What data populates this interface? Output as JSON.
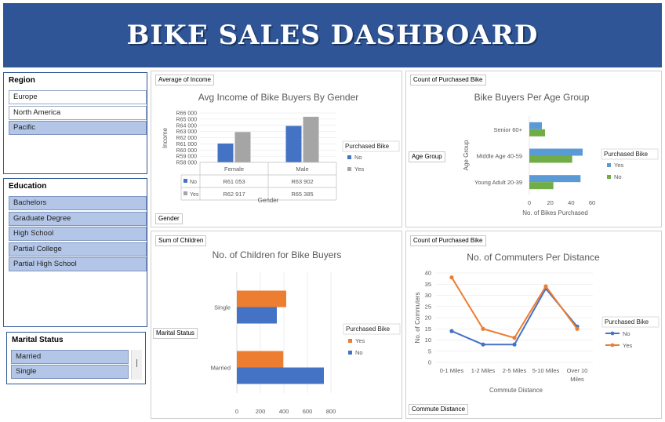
{
  "header": {
    "title": "BIKE SALES DASHBOARD"
  },
  "slicers": {
    "region": {
      "title": "Region",
      "items": [
        {
          "label": "Europe",
          "selected": false
        },
        {
          "label": "North America",
          "selected": false
        },
        {
          "label": "Pacific",
          "selected": true
        }
      ]
    },
    "education": {
      "title": "Education",
      "items": [
        {
          "label": "Bachelors",
          "selected": true
        },
        {
          "label": "Graduate Degree",
          "selected": true
        },
        {
          "label": "High School",
          "selected": true
        },
        {
          "label": "Partial College",
          "selected": true
        },
        {
          "label": "Partial High School",
          "selected": true
        }
      ]
    },
    "marital": {
      "title": "Marital Status",
      "items": [
        {
          "label": "Married",
          "selected": true
        },
        {
          "label": "Single",
          "selected": true
        }
      ]
    }
  },
  "colors": {
    "banner": "#2f5597",
    "no": "#4472c4",
    "yes": "#a5a5a5",
    "green": "#70ad47",
    "lightblue": "#5b9bd5",
    "orange": "#ed7d31"
  },
  "chart_data": [
    {
      "id": "income",
      "type": "bar",
      "field_button": "Average of Income",
      "axis_field_button": "Gender",
      "title": "Avg Income of Bike Buyers By Gender",
      "ylabel": "Income",
      "xlabel": "Gender",
      "categories": [
        "Female",
        "Male"
      ],
      "ylim": [
        58000,
        66000
      ],
      "yticks": [
        "R66 000",
        "R65 000",
        "R64 000",
        "R63 000",
        "R62 000",
        "R61 000",
        "R60 000",
        "R59 000",
        "R58 000"
      ],
      "legend_title": "Purchased Bike",
      "legend_placement": "right",
      "series": [
        {
          "name": "No",
          "values": [
            61053,
            63902
          ],
          "labels": [
            "R61 053",
            "R63 902"
          ],
          "color": "#4472c4"
        },
        {
          "name": "Yes",
          "values": [
            62917,
            65385
          ],
          "labels": [
            "R62 917",
            "R65 385"
          ],
          "color": "#a5a5a5"
        }
      ]
    },
    {
      "id": "age",
      "type": "bar",
      "orientation": "horizontal",
      "field_button": "Count of Purchased Bike",
      "axis_field_button": "Age Group",
      "title": "Bike Buyers Per Age Group",
      "ylabel": "Age Group",
      "xlabel": "No. of Bikes Purchased",
      "categories": [
        "Senior 60+",
        "Middle Age 40-59",
        "Young Adult 20-39"
      ],
      "xlim": [
        0,
        60
      ],
      "xticks": [
        0,
        20,
        40,
        60
      ],
      "legend_title": "Purchased Bike",
      "legend_placement": "right",
      "series": [
        {
          "name": "Yes",
          "values": [
            12,
            51,
            49
          ],
          "color": "#5b9bd5"
        },
        {
          "name": "No",
          "values": [
            15,
            41,
            23
          ],
          "color": "#70ad47"
        }
      ]
    },
    {
      "id": "children",
      "type": "bar",
      "orientation": "horizontal",
      "field_button": "Sum of Children",
      "axis_field_button": "Marital Status",
      "title": "No. of Children for Bike Buyers",
      "categories": [
        "Single",
        "Married"
      ],
      "xlim": [
        0,
        800
      ],
      "xticks": [
        0,
        200,
        400,
        600,
        800
      ],
      "legend_title": "Purchased Bike",
      "legend_placement": "right",
      "series": [
        {
          "name": "Yes",
          "values": [
            420,
            395
          ],
          "color": "#ed7d31"
        },
        {
          "name": "No",
          "values": [
            340,
            740
          ],
          "color": "#4472c4"
        }
      ]
    },
    {
      "id": "commute",
      "type": "line",
      "field_button": "Count of Purchased Bike",
      "axis_field_button": "Commute Distance",
      "title": "No. of Commuters Per Distance",
      "ylabel": "No. of Commuters",
      "xlabel": "Commute Distance",
      "categories": [
        "0-1 Miles",
        "1-2 Miles",
        "2-5 Miles",
        "5-10 Miles",
        "Over 10 Miles"
      ],
      "ylim": [
        0,
        40
      ],
      "yticks": [
        0,
        5,
        10,
        15,
        20,
        25,
        30,
        35,
        40
      ],
      "grid": true,
      "legend_title": "Purchased Bike",
      "legend_placement": "right",
      "series": [
        {
          "name": "No",
          "values": [
            14,
            8,
            8,
            33,
            16
          ],
          "color": "#4472c4"
        },
        {
          "name": "Yes",
          "values": [
            38,
            15,
            11,
            34,
            15
          ],
          "color": "#ed7d31"
        }
      ]
    }
  ]
}
